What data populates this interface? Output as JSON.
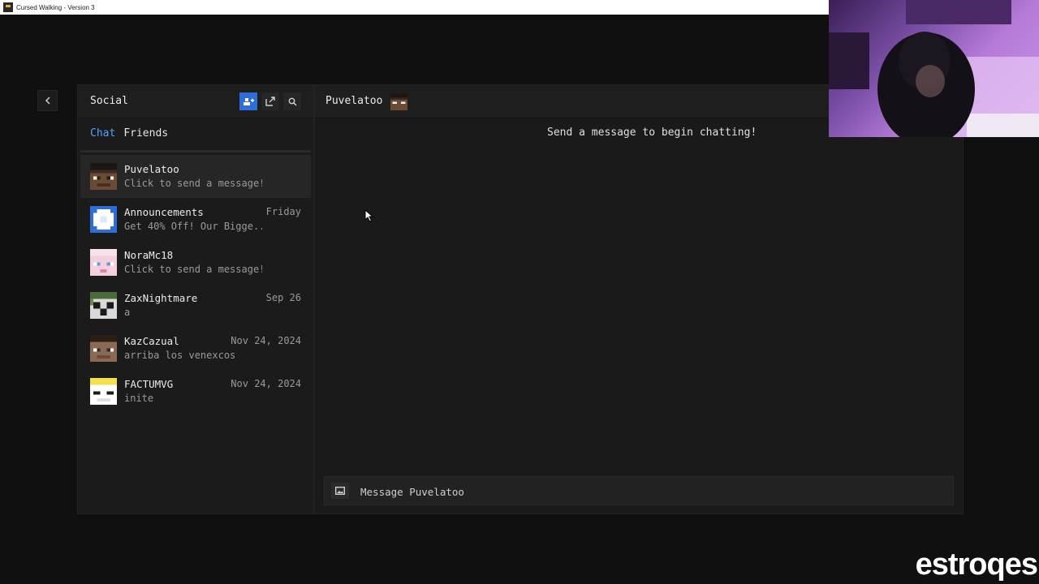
{
  "window": {
    "title": "Cursed Walking - Version 3"
  },
  "nav": {
    "back_icon": "chevron-left-icon"
  },
  "social": {
    "title": "Social",
    "buttons": [
      {
        "icon": "add-friend-icon"
      },
      {
        "icon": "share-icon"
      },
      {
        "icon": "search-icon"
      }
    ],
    "tabs": [
      {
        "label": "Chat",
        "active": true
      },
      {
        "label": "Friends",
        "active": false
      }
    ],
    "accent_color": "#4aa3ff",
    "conversations": [
      {
        "name": "Puvelatoo",
        "message": "Click to send a message!",
        "date": "",
        "selected": true
      },
      {
        "name": "Announcements",
        "message": "Get 40% Off! Our Bigge...",
        "date": "Friday",
        "selected": false
      },
      {
        "name": "NoraMc18",
        "message": "Click to send a message!",
        "date": "",
        "selected": false
      },
      {
        "name": "ZaxNightmare",
        "message": "a",
        "date": "Sep 26",
        "selected": false
      },
      {
        "name": "KazCazual",
        "message": "arriba los venexcos",
        "date": "Nov 24, 2024",
        "selected": false
      },
      {
        "name": "FACTUMVG",
        "message": "inite",
        "date": "Nov 24, 2024",
        "selected": false
      }
    ]
  },
  "chat": {
    "recipient": "Puvelatoo",
    "empty_state": "Send a message to begin chatting!",
    "input_placeholder": "Message Puvelatoo",
    "image_icon": "image-icon"
  },
  "overlay": {
    "webcam": "webcam-feed",
    "watermark": "estroqes"
  }
}
